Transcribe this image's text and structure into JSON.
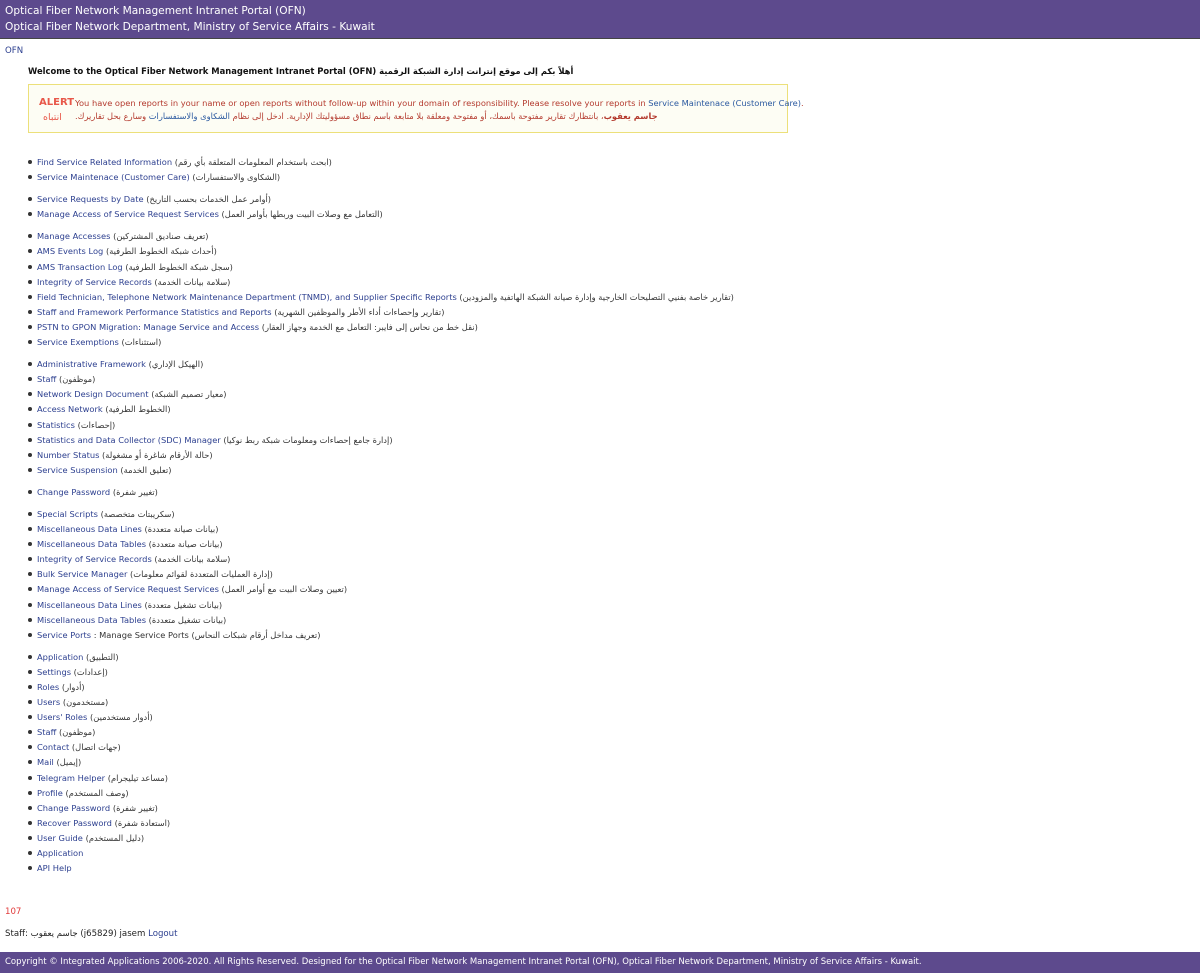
{
  "header": {
    "title": "Optical Fiber Network Management Intranet Portal (OFN)",
    "subtitle": "Optical Fiber Network Department, Ministry of Service Affairs - Kuwait"
  },
  "breadcrumb": "OFN",
  "welcome": "Welcome to the Optical Fiber Network Management Intranet Portal (OFN) أهلاً بكم إلى موقع إنترانت إدارة الشبكة الرقمية",
  "alert": {
    "tag": "ALERT",
    "tag_ar": "انتباه",
    "line1_text": "You have open reports in your name or open reports without follow-up within your domain of responsibility. Please resolve your reports in",
    "line1_link": "Service Maintenace (Customer Care)",
    "line1_end": ".",
    "line2_name": "جاسم يعقوب",
    "line2_text": "، بانتظارك تقارير مفتوحة باسمك، أو مفتوحة ومعلقة بلا متابعة باسم نطاق مسؤوليتك الإدارية. ادخل إلى نظام",
    "line2_link": "الشكاوى والاستفسارات",
    "line2_end": "وسارع بحل تقاريرك."
  },
  "menu": [
    {
      "label": "Find Service Related Information",
      "ar": "(ابحث باستخدام المعلومات المتعلقة بأي رقم)",
      "gap": false
    },
    {
      "label": "Service Maintenace (Customer Care)",
      "ar": "(الشكاوى والاستفسارات)",
      "gap": false
    },
    {
      "label": "Service Requests by Date",
      "ar": "(أوامر عمل الخدمات بحسب التاريخ)",
      "gap": true
    },
    {
      "label": "Manage Access of Service Request Services",
      "ar": "(التعامل مع وصلات البيت وربطها بأوامر العمل)",
      "gap": false
    },
    {
      "label": "Manage Accesses",
      "ar": "(تعريف صناديق المشتركين)",
      "gap": true
    },
    {
      "label": "AMS Events Log",
      "ar": "(أحداث شبكة الخطوط الطرفية)",
      "gap": false
    },
    {
      "label": "AMS Transaction Log",
      "ar": "(سجل شبكة الخطوط الطرفية)",
      "gap": false
    },
    {
      "label": "Integrity of Service Records",
      "ar": "(سلامة بيانات الخدمة)",
      "gap": false
    },
    {
      "label": "Field Technician, Telephone Network Maintenance Department (TNMD), and Supplier Specific Reports",
      "ar": "(تقارير خاصة بفنيي التصليحات الخارجية وإدارة صيانة الشبكة الهاتفية والمزودين)",
      "gap": false
    },
    {
      "label": "Staff and Framework Performance Statistics and Reports",
      "ar": "(تقارير وإحصاءات أداء الأطر والموظفين الشهرية)",
      "gap": false
    },
    {
      "label": "PSTN to GPON Migration: Manage Service and Access",
      "ar": "(نقل خط من نحاس إلى فايبر: التعامل مع الخدمة وجهاز العقار)",
      "gap": false
    },
    {
      "label": "Service Exemptions",
      "ar": "(استثناءات)",
      "gap": false
    },
    {
      "label": "Administrative Framework",
      "ar": "(الهيكل الإداري)",
      "gap": true
    },
    {
      "label": "Staff",
      "ar": "(موظفون)",
      "gap": false
    },
    {
      "label": "Network Design Document",
      "ar": "(معيار تصميم الشبكة)",
      "gap": false
    },
    {
      "label": "Access Network",
      "ar": "(الخطوط الطرفية)",
      "gap": false
    },
    {
      "label": "Statistics",
      "ar": "(إحصاءات)",
      "gap": false
    },
    {
      "label": "Statistics and Data Collector (SDC) Manager",
      "ar": "(إدارة جامع إحصاءات ومعلومات شبكة ربط نوكيا)",
      "gap": false
    },
    {
      "label": "Number Status",
      "ar": "(حالة الأرقام شاغرة أو مشغولة)",
      "gap": false
    },
    {
      "label": "Service Suspension",
      "ar": "(تعليق الخدمة)",
      "gap": false
    },
    {
      "label": "Change Password",
      "ar": "(تغيير شفرة)",
      "gap": true
    },
    {
      "label": "Special Scripts",
      "ar": "(سكريبتات متخصصة)",
      "gap": true
    },
    {
      "label": "Miscellaneous Data Lines",
      "ar": "(بيانات صيانة متعددة)",
      "gap": false
    },
    {
      "label": "Miscellaneous Data Tables",
      "ar": "(بيانات صيانة متعددة)",
      "gap": false
    },
    {
      "label": "Integrity of Service Records",
      "ar": "(سلامة بيانات الخدمة)",
      "gap": false
    },
    {
      "label": "Bulk Service Manager",
      "ar": "(إدارة العمليات المتعددة لقوائم معلومات)",
      "gap": false
    },
    {
      "label": "Manage Access of Service Request Services",
      "ar": "(تعيين وصلات البيت مع أوامر العمل)",
      "gap": false
    },
    {
      "label": "Miscellaneous Data Lines",
      "ar": "(بيانات تشغيل متعددة)",
      "gap": false
    },
    {
      "label": "Miscellaneous Data Tables",
      "ar": "(بيانات تشغيل متعددة)",
      "gap": false
    },
    {
      "label": "Service Ports",
      "ar": ": Manage Service Ports (تعريف مداخل أرقام شبكات النحاس)",
      "gap": false
    },
    {
      "label": "Application",
      "ar": "(التطبيق)",
      "gap": true
    },
    {
      "label": "Settings",
      "ar": "(إعدادات)",
      "gap": false
    },
    {
      "label": "Roles",
      "ar": "(أدوار)",
      "gap": false
    },
    {
      "label": "Users",
      "ar": "(مستخدمون)",
      "gap": false
    },
    {
      "label": "Users' Roles",
      "ar": "(أدوار مستخدمين)",
      "gap": false
    },
    {
      "label": "Staff",
      "ar": "(موظفون)",
      "gap": false
    },
    {
      "label": "Contact",
      "ar": "(جهات اتصال)",
      "gap": false
    },
    {
      "label": "Mail",
      "ar": "(إيميل)",
      "gap": false
    },
    {
      "label": "Telegram Helper",
      "ar": "(مساعد تيليجرام)",
      "gap": false
    },
    {
      "label": "Profile",
      "ar": "(وصف المستخدم)",
      "gap": false
    },
    {
      "label": "Change Password",
      "ar": "(تغيير شفرة)",
      "gap": false
    },
    {
      "label": "Recover Password",
      "ar": "(استعادة شفرة)",
      "gap": false
    },
    {
      "label": "User Guide",
      "ar": "(دليل المستخدم)",
      "gap": false
    },
    {
      "label": "Application",
      "ar": "",
      "gap": false
    },
    {
      "label": "API Help",
      "ar": "",
      "gap": false
    }
  ],
  "counter": "107",
  "staff": {
    "prefix": "Staff: جاسم يعقوب (j65829) jasem",
    "logout": "Logout"
  },
  "footer": "Copyright © Integrated Applications 2006-2020. All Rights Reserved. Designed for the Optical Fiber Network Management Intranet Portal (OFN), Optical Fiber Network Department, Ministry of Service Affairs - Kuwait."
}
